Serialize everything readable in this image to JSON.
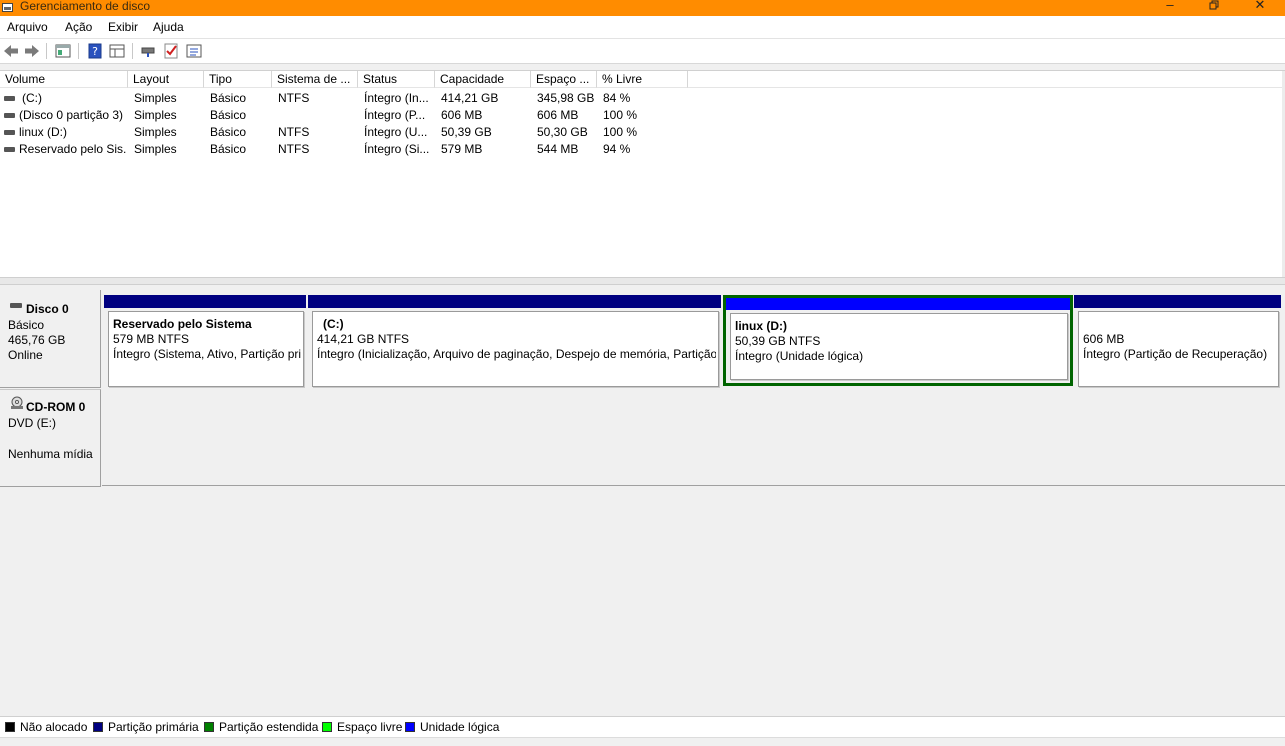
{
  "window": {
    "title": "Gerenciamento de disco"
  },
  "menu": [
    "Arquivo",
    "Ação",
    "Exibir",
    "Ajuda"
  ],
  "columns": [
    "Volume",
    "Layout",
    "Tipo",
    "Sistema de ...",
    "Status",
    "Capacidade",
    "Espaço ...",
    "% Livre"
  ],
  "volumes": [
    {
      "volume": "(C:)",
      "layout": "Simples",
      "type": "Básico",
      "fs": "NTFS",
      "status": "Íntegro (In...",
      "capacity": "414,21 GB",
      "free": "345,98 GB",
      "pct": "84 %"
    },
    {
      "volume": "(Disco 0 partição 3)",
      "layout": "Simples",
      "type": "Básico",
      "fs": "",
      "status": "Íntegro (P...",
      "capacity": "606 MB",
      "free": "606 MB",
      "pct": "100 %"
    },
    {
      "volume": "linux (D:)",
      "layout": "Simples",
      "type": "Básico",
      "fs": "NTFS",
      "status": "Íntegro (U...",
      "capacity": "50,39 GB",
      "free": "50,30 GB",
      "pct": "100 %"
    },
    {
      "volume": "Reservado pelo Sis...",
      "layout": "Simples",
      "type": "Básico",
      "fs": "NTFS",
      "status": "Íntegro (Si...",
      "capacity": "579 MB",
      "free": "544 MB",
      "pct": "94 %"
    }
  ],
  "disk0": {
    "name": "Disco 0",
    "kind": "Básico",
    "size": "465,76 GB",
    "state": "Online",
    "partitions": [
      {
        "name": "Reservado pelo Sistema",
        "size": "579 MB NTFS",
        "status": "Íntegro (Sistema, Ativo, Partição primária)",
        "bar_color": "#000080"
      },
      {
        "name": "(C:)",
        "size": "414,21 GB NTFS",
        "status": "Íntegro (Inicialização, Arquivo de paginação, Despejo de memória, Partição primária)",
        "bar_color": "#000080"
      },
      {
        "name": "linux  (D:)",
        "size": "50,39 GB NTFS",
        "status": "Íntegro (Unidade lógica)",
        "bar_color": "#0000ff"
      },
      {
        "name": "",
        "size": "606 MB",
        "status": "Íntegro (Partição de Recuperação)",
        "bar_color": "#000080"
      }
    ]
  },
  "cdrom0": {
    "name": "CD-ROM 0",
    "drive": "DVD (E:)",
    "media": "Nenhuma mídia"
  },
  "legend": [
    {
      "label": "Não alocado",
      "color": "#000000"
    },
    {
      "label": "Partição primária",
      "color": "#000080"
    },
    {
      "label": "Partição estendida",
      "color": "#008000"
    },
    {
      "label": "Espaço livre",
      "color": "#00ff00"
    },
    {
      "label": "Unidade lógica",
      "color": "#0000ff"
    }
  ],
  "colors": {
    "titlebar": "#ff8c00",
    "selection": "#006400"
  },
  "toolbar_icons": [
    "back-arrow-icon",
    "forward-arrow-icon",
    "properties-panel-icon",
    "help-icon",
    "console-view-icon",
    "connect-drive-icon",
    "checklist-icon",
    "properties-list-icon"
  ]
}
